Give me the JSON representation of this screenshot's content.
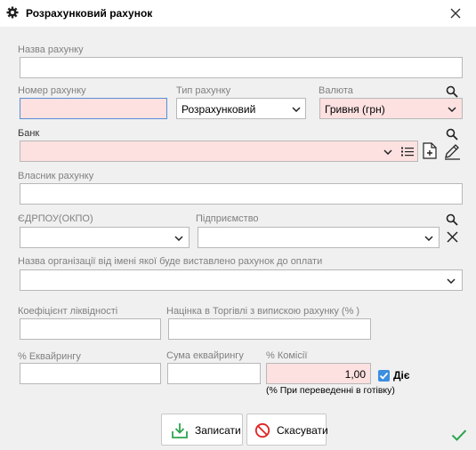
{
  "window": {
    "title": "Розрахунковий рахунок"
  },
  "fields": {
    "account_name_label": "Назва рахунку",
    "account_number_label": "Номер рахунку",
    "account_type_label": "Тип рахунку",
    "account_type_value": "Розрахунковий",
    "currency_label": "Валюта",
    "currency_value": "Гривня (грн)",
    "bank_label": "Банк",
    "owner_label": "Власник рахунку",
    "edrpou_label": "ЄДРПОУ(ОКПО)",
    "enterprise_label": "Підприємство",
    "org_name_label": "Назва організації від імені якої буде виставлено рахунок до оплати",
    "liquidity_label": "Коефіцієнт ліквідності",
    "markup_label": "Націнка в Торгівлі з випискою рахунку (% )",
    "acquiring_pct_label": "% Еквайрингу",
    "acquiring_sum_label": "Сума еквайрингу",
    "commission_label": "% Комісії",
    "commission_value": "1,00",
    "active_label": "Діє",
    "active_checked": true,
    "cash_note": "(% При переведенні в готівку)"
  },
  "buttons": {
    "save": "Записати",
    "cancel": "Скасувати"
  },
  "colors": {
    "required_bg": "#fde0e0",
    "checkbox": "#3b8ee0",
    "save_icon": "#2ea44f",
    "cancel_icon": "#e02020",
    "ok": "#2ea44f"
  }
}
